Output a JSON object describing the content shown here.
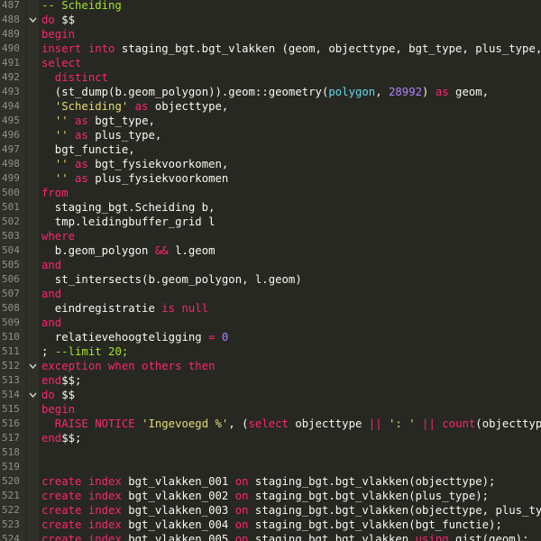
{
  "editor": {
    "lines": [
      {
        "num": "487",
        "fold": "",
        "tokens": [
          {
            "t": "-- Scheiding",
            "c": "green"
          }
        ]
      },
      {
        "num": "488",
        "fold": "v",
        "tokens": [
          {
            "t": "do",
            "c": "kw"
          },
          {
            "t": " $$",
            "c": "txt"
          }
        ]
      },
      {
        "num": "489",
        "fold": "",
        "tokens": [
          {
            "t": "begin",
            "c": "kw"
          }
        ]
      },
      {
        "num": "490",
        "fold": "",
        "tokens": [
          {
            "t": "insert into",
            "c": "kw"
          },
          {
            "t": " staging_bgt.bgt_vlakken (geom, objecttype, bgt_type, plus_type, bgt",
            "c": "txt"
          }
        ]
      },
      {
        "num": "491",
        "fold": "",
        "tokens": [
          {
            "t": "select",
            "c": "kw"
          }
        ]
      },
      {
        "num": "492",
        "fold": "",
        "tokens": [
          {
            "t": "  distinct",
            "c": "kw"
          }
        ]
      },
      {
        "num": "493",
        "fold": "",
        "tokens": [
          {
            "t": "  (",
            "c": "txt"
          },
          {
            "t": "st_dump",
            "c": "txt"
          },
          {
            "t": "(b.geom_polygon)).geom::geometry(",
            "c": "txt"
          },
          {
            "t": "polygon",
            "c": "type"
          },
          {
            "t": ", ",
            "c": "txt"
          },
          {
            "t": "28992",
            "c": "num"
          },
          {
            "t": ") ",
            "c": "txt"
          },
          {
            "t": "as",
            "c": "kw"
          },
          {
            "t": " geom,",
            "c": "txt"
          }
        ]
      },
      {
        "num": "494",
        "fold": "",
        "tokens": [
          {
            "t": "  ",
            "c": "txt"
          },
          {
            "t": "'Scheiding'",
            "c": "str"
          },
          {
            "t": " ",
            "c": "txt"
          },
          {
            "t": "as",
            "c": "kw"
          },
          {
            "t": " objecttype,",
            "c": "txt"
          }
        ]
      },
      {
        "num": "495",
        "fold": "",
        "tokens": [
          {
            "t": "  ",
            "c": "txt"
          },
          {
            "t": "''",
            "c": "str"
          },
          {
            "t": " ",
            "c": "txt"
          },
          {
            "t": "as",
            "c": "kw"
          },
          {
            "t": " bgt_type,",
            "c": "txt"
          }
        ]
      },
      {
        "num": "496",
        "fold": "",
        "tokens": [
          {
            "t": "  ",
            "c": "txt"
          },
          {
            "t": "''",
            "c": "str"
          },
          {
            "t": " ",
            "c": "txt"
          },
          {
            "t": "as",
            "c": "kw"
          },
          {
            "t": " plus_type,",
            "c": "txt"
          }
        ]
      },
      {
        "num": "497",
        "fold": "",
        "tokens": [
          {
            "t": "  bgt_functie,",
            "c": "txt"
          }
        ]
      },
      {
        "num": "498",
        "fold": "",
        "tokens": [
          {
            "t": "  ",
            "c": "txt"
          },
          {
            "t": "''",
            "c": "str"
          },
          {
            "t": " ",
            "c": "txt"
          },
          {
            "t": "as",
            "c": "kw"
          },
          {
            "t": " bgt_fysiekvoorkomen,",
            "c": "txt"
          }
        ]
      },
      {
        "num": "499",
        "fold": "",
        "tokens": [
          {
            "t": "  ",
            "c": "txt"
          },
          {
            "t": "''",
            "c": "str"
          },
          {
            "t": " ",
            "c": "txt"
          },
          {
            "t": "as",
            "c": "kw"
          },
          {
            "t": " plus_fysiekvoorkomen",
            "c": "txt"
          }
        ]
      },
      {
        "num": "500",
        "fold": "",
        "tokens": [
          {
            "t": "from",
            "c": "kw"
          }
        ]
      },
      {
        "num": "501",
        "fold": "",
        "tokens": [
          {
            "t": "  staging_bgt.Scheiding b,",
            "c": "txt"
          }
        ]
      },
      {
        "num": "502",
        "fold": "",
        "tokens": [
          {
            "t": "  tmp.leidingbuffer_grid l",
            "c": "txt"
          }
        ]
      },
      {
        "num": "503",
        "fold": "",
        "tokens": [
          {
            "t": "where",
            "c": "kw"
          }
        ]
      },
      {
        "num": "504",
        "fold": "",
        "tokens": [
          {
            "t": "  b.geom_polygon ",
            "c": "txt"
          },
          {
            "t": "&&",
            "c": "kw"
          },
          {
            "t": " l.geom",
            "c": "txt"
          }
        ]
      },
      {
        "num": "505",
        "fold": "",
        "tokens": [
          {
            "t": "and",
            "c": "kw"
          }
        ]
      },
      {
        "num": "506",
        "fold": "",
        "tokens": [
          {
            "t": "  st_intersects(b.geom_polygon, l.geom)",
            "c": "txt"
          }
        ]
      },
      {
        "num": "507",
        "fold": "",
        "tokens": [
          {
            "t": "and",
            "c": "kw"
          }
        ]
      },
      {
        "num": "508",
        "fold": "",
        "tokens": [
          {
            "t": "  eindregistratie ",
            "c": "txt"
          },
          {
            "t": "is null",
            "c": "kw"
          }
        ]
      },
      {
        "num": "509",
        "fold": "",
        "tokens": [
          {
            "t": "and",
            "c": "kw"
          }
        ]
      },
      {
        "num": "510",
        "fold": "",
        "tokens": [
          {
            "t": "  relatievehoogteligging ",
            "c": "txt"
          },
          {
            "t": "=",
            "c": "kw"
          },
          {
            "t": " ",
            "c": "txt"
          },
          {
            "t": "0",
            "c": "num"
          }
        ]
      },
      {
        "num": "511",
        "fold": "",
        "tokens": [
          {
            "t": "; ",
            "c": "txt"
          },
          {
            "t": "--limit 20;",
            "c": "green"
          }
        ]
      },
      {
        "num": "512",
        "fold": "v",
        "tokens": [
          {
            "t": "exception when others then",
            "c": "kw"
          }
        ]
      },
      {
        "num": "513",
        "fold": "",
        "tokens": [
          {
            "t": "end",
            "c": "kw"
          },
          {
            "t": "$$;",
            "c": "txt"
          }
        ]
      },
      {
        "num": "514",
        "fold": "v",
        "tokens": [
          {
            "t": "do",
            "c": "kw"
          },
          {
            "t": " $$",
            "c": "txt"
          }
        ]
      },
      {
        "num": "515",
        "fold": "",
        "tokens": [
          {
            "t": "begin",
            "c": "kw"
          }
        ]
      },
      {
        "num": "516",
        "fold": "",
        "tokens": [
          {
            "t": "  RAISE NOTICE ",
            "c": "kw"
          },
          {
            "t": "'Ingevoegd %'",
            "c": "str"
          },
          {
            "t": ", (",
            "c": "txt"
          },
          {
            "t": "select",
            "c": "kw"
          },
          {
            "t": " objecttype ",
            "c": "txt"
          },
          {
            "t": "||",
            "c": "kw"
          },
          {
            "t": " ",
            "c": "txt"
          },
          {
            "t": "': '",
            "c": "str"
          },
          {
            "t": " ",
            "c": "txt"
          },
          {
            "t": "||",
            "c": "kw"
          },
          {
            "t": " ",
            "c": "txt"
          },
          {
            "t": "count",
            "c": "kw"
          },
          {
            "t": "(objecttype)",
            "c": "txt"
          }
        ]
      },
      {
        "num": "517",
        "fold": "",
        "tokens": [
          {
            "t": "end",
            "c": "kw"
          },
          {
            "t": "$$;",
            "c": "txt"
          }
        ]
      },
      {
        "num": "518",
        "fold": "",
        "tokens": []
      },
      {
        "num": "519",
        "fold": "",
        "tokens": []
      },
      {
        "num": "520",
        "fold": "",
        "tokens": [
          {
            "t": "create index",
            "c": "kw"
          },
          {
            "t": " bgt_vlakken_001 ",
            "c": "txt"
          },
          {
            "t": "on",
            "c": "kw"
          },
          {
            "t": " staging_bgt.bgt_vlakken(objecttype);",
            "c": "txt"
          }
        ]
      },
      {
        "num": "521",
        "fold": "",
        "tokens": [
          {
            "t": "create index",
            "c": "kw"
          },
          {
            "t": " bgt_vlakken_002 ",
            "c": "txt"
          },
          {
            "t": "on",
            "c": "kw"
          },
          {
            "t": " staging_bgt.bgt_vlakken(plus_type);",
            "c": "txt"
          }
        ]
      },
      {
        "num": "522",
        "fold": "",
        "tokens": [
          {
            "t": "create index",
            "c": "kw"
          },
          {
            "t": " bgt_vlakken_003 ",
            "c": "txt"
          },
          {
            "t": "on",
            "c": "kw"
          },
          {
            "t": " staging_bgt.bgt_vlakken(objecttype, plus_type);",
            "c": "txt"
          }
        ]
      },
      {
        "num": "523",
        "fold": "",
        "tokens": [
          {
            "t": "create index",
            "c": "kw"
          },
          {
            "t": " bgt_vlakken_004 ",
            "c": "txt"
          },
          {
            "t": "on",
            "c": "kw"
          },
          {
            "t": " staging_bgt.bgt_vlakken(bgt_functie);",
            "c": "txt"
          }
        ]
      },
      {
        "num": "524",
        "fold": "",
        "tokens": [
          {
            "t": "create index",
            "c": "kw"
          },
          {
            "t": " bgt_vlakken_005 ",
            "c": "txt"
          },
          {
            "t": "on",
            "c": "kw"
          },
          {
            "t": " staging_bgt.bgt_vlakken ",
            "c": "txt"
          },
          {
            "t": "using",
            "c": "kw"
          },
          {
            "t": " gist(geom);",
            "c": "txt"
          }
        ]
      }
    ],
    "colors": {
      "background": "#272822",
      "gutter": "#2f3129",
      "keyword": "#f92672",
      "string": "#e6db74",
      "number": "#ae81ff",
      "type": "#66d9ef",
      "comment": "#a6e22e",
      "text": "#f8f8f2"
    }
  }
}
